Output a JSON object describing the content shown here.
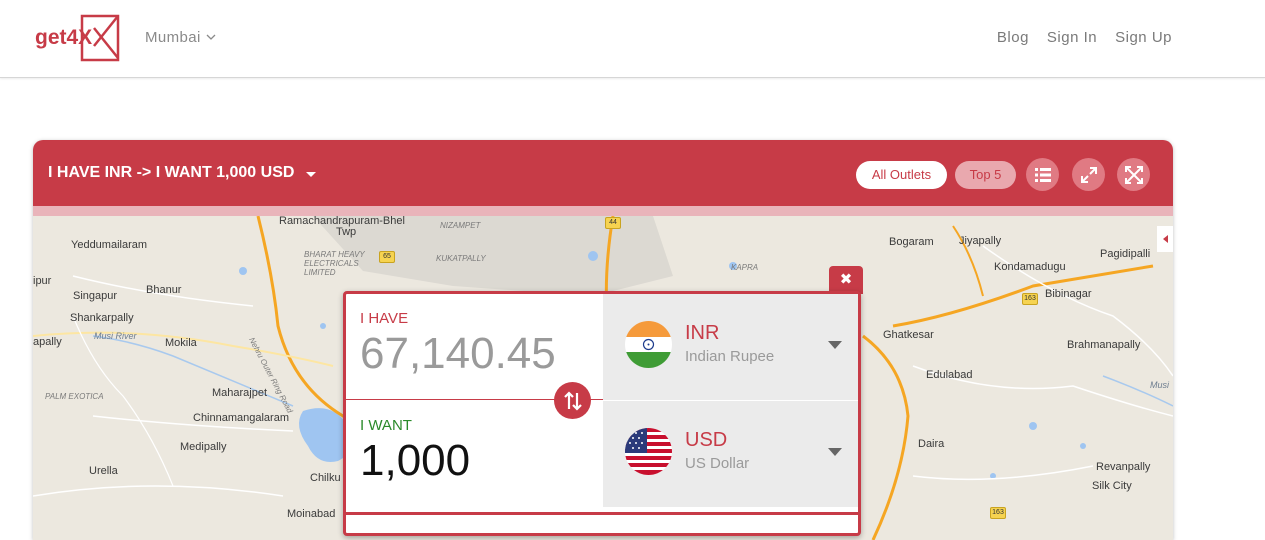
{
  "nav": {
    "brand": "get4X",
    "city": "Mumbai",
    "links": [
      "Blog",
      "Sign In",
      "Sign Up"
    ]
  },
  "header": {
    "title": "I HAVE INR -> I WANT 1,000 USD",
    "all_outlets": "All Outlets",
    "top5": "Top 5"
  },
  "map": {
    "labels": [
      "Ramachandrapuram-Bhel",
      "Twp",
      "NIZAMPET",
      "Yeddumailaram",
      "Bhanur",
      "Singapur",
      "Shankarpally",
      "apally",
      "Musi River",
      "Mokila",
      "Maharajpet",
      "Chinnamangalaram",
      "Medipally",
      "Urella",
      "Chilku",
      "Moinabad",
      "PALM EXOTICA",
      "BHARAT HEAVY ELECTRICALS LIMITED",
      "KUKATPALLY",
      "KAPRA",
      "Bogaram",
      "Jiyapally",
      "Pagidipalli",
      "Kondamadugu",
      "Bibinagar",
      "Ghatkesar",
      "Brahmanapally",
      "Edulabad",
      "Daira",
      "Revanpally",
      "Silk City",
      "Nehru Outer Ring Road",
      "ipur",
      "Musi"
    ],
    "shields": [
      "65",
      "44",
      "163",
      "163"
    ]
  },
  "converter": {
    "have_label": "I HAVE",
    "have_value": "67,140.45",
    "have_code": "INR",
    "have_name": "Indian Rupee",
    "want_label": "I WANT",
    "want_value": "1,000",
    "want_code": "USD",
    "want_name": "US Dollar"
  },
  "colors": {
    "brand": "#c73b47",
    "want_label": "#2a8a2a"
  },
  "icons": [
    "list-icon",
    "expand-icon",
    "fullscreen-icon",
    "close-icon",
    "swap-icon",
    "chevron-down-icon"
  ]
}
